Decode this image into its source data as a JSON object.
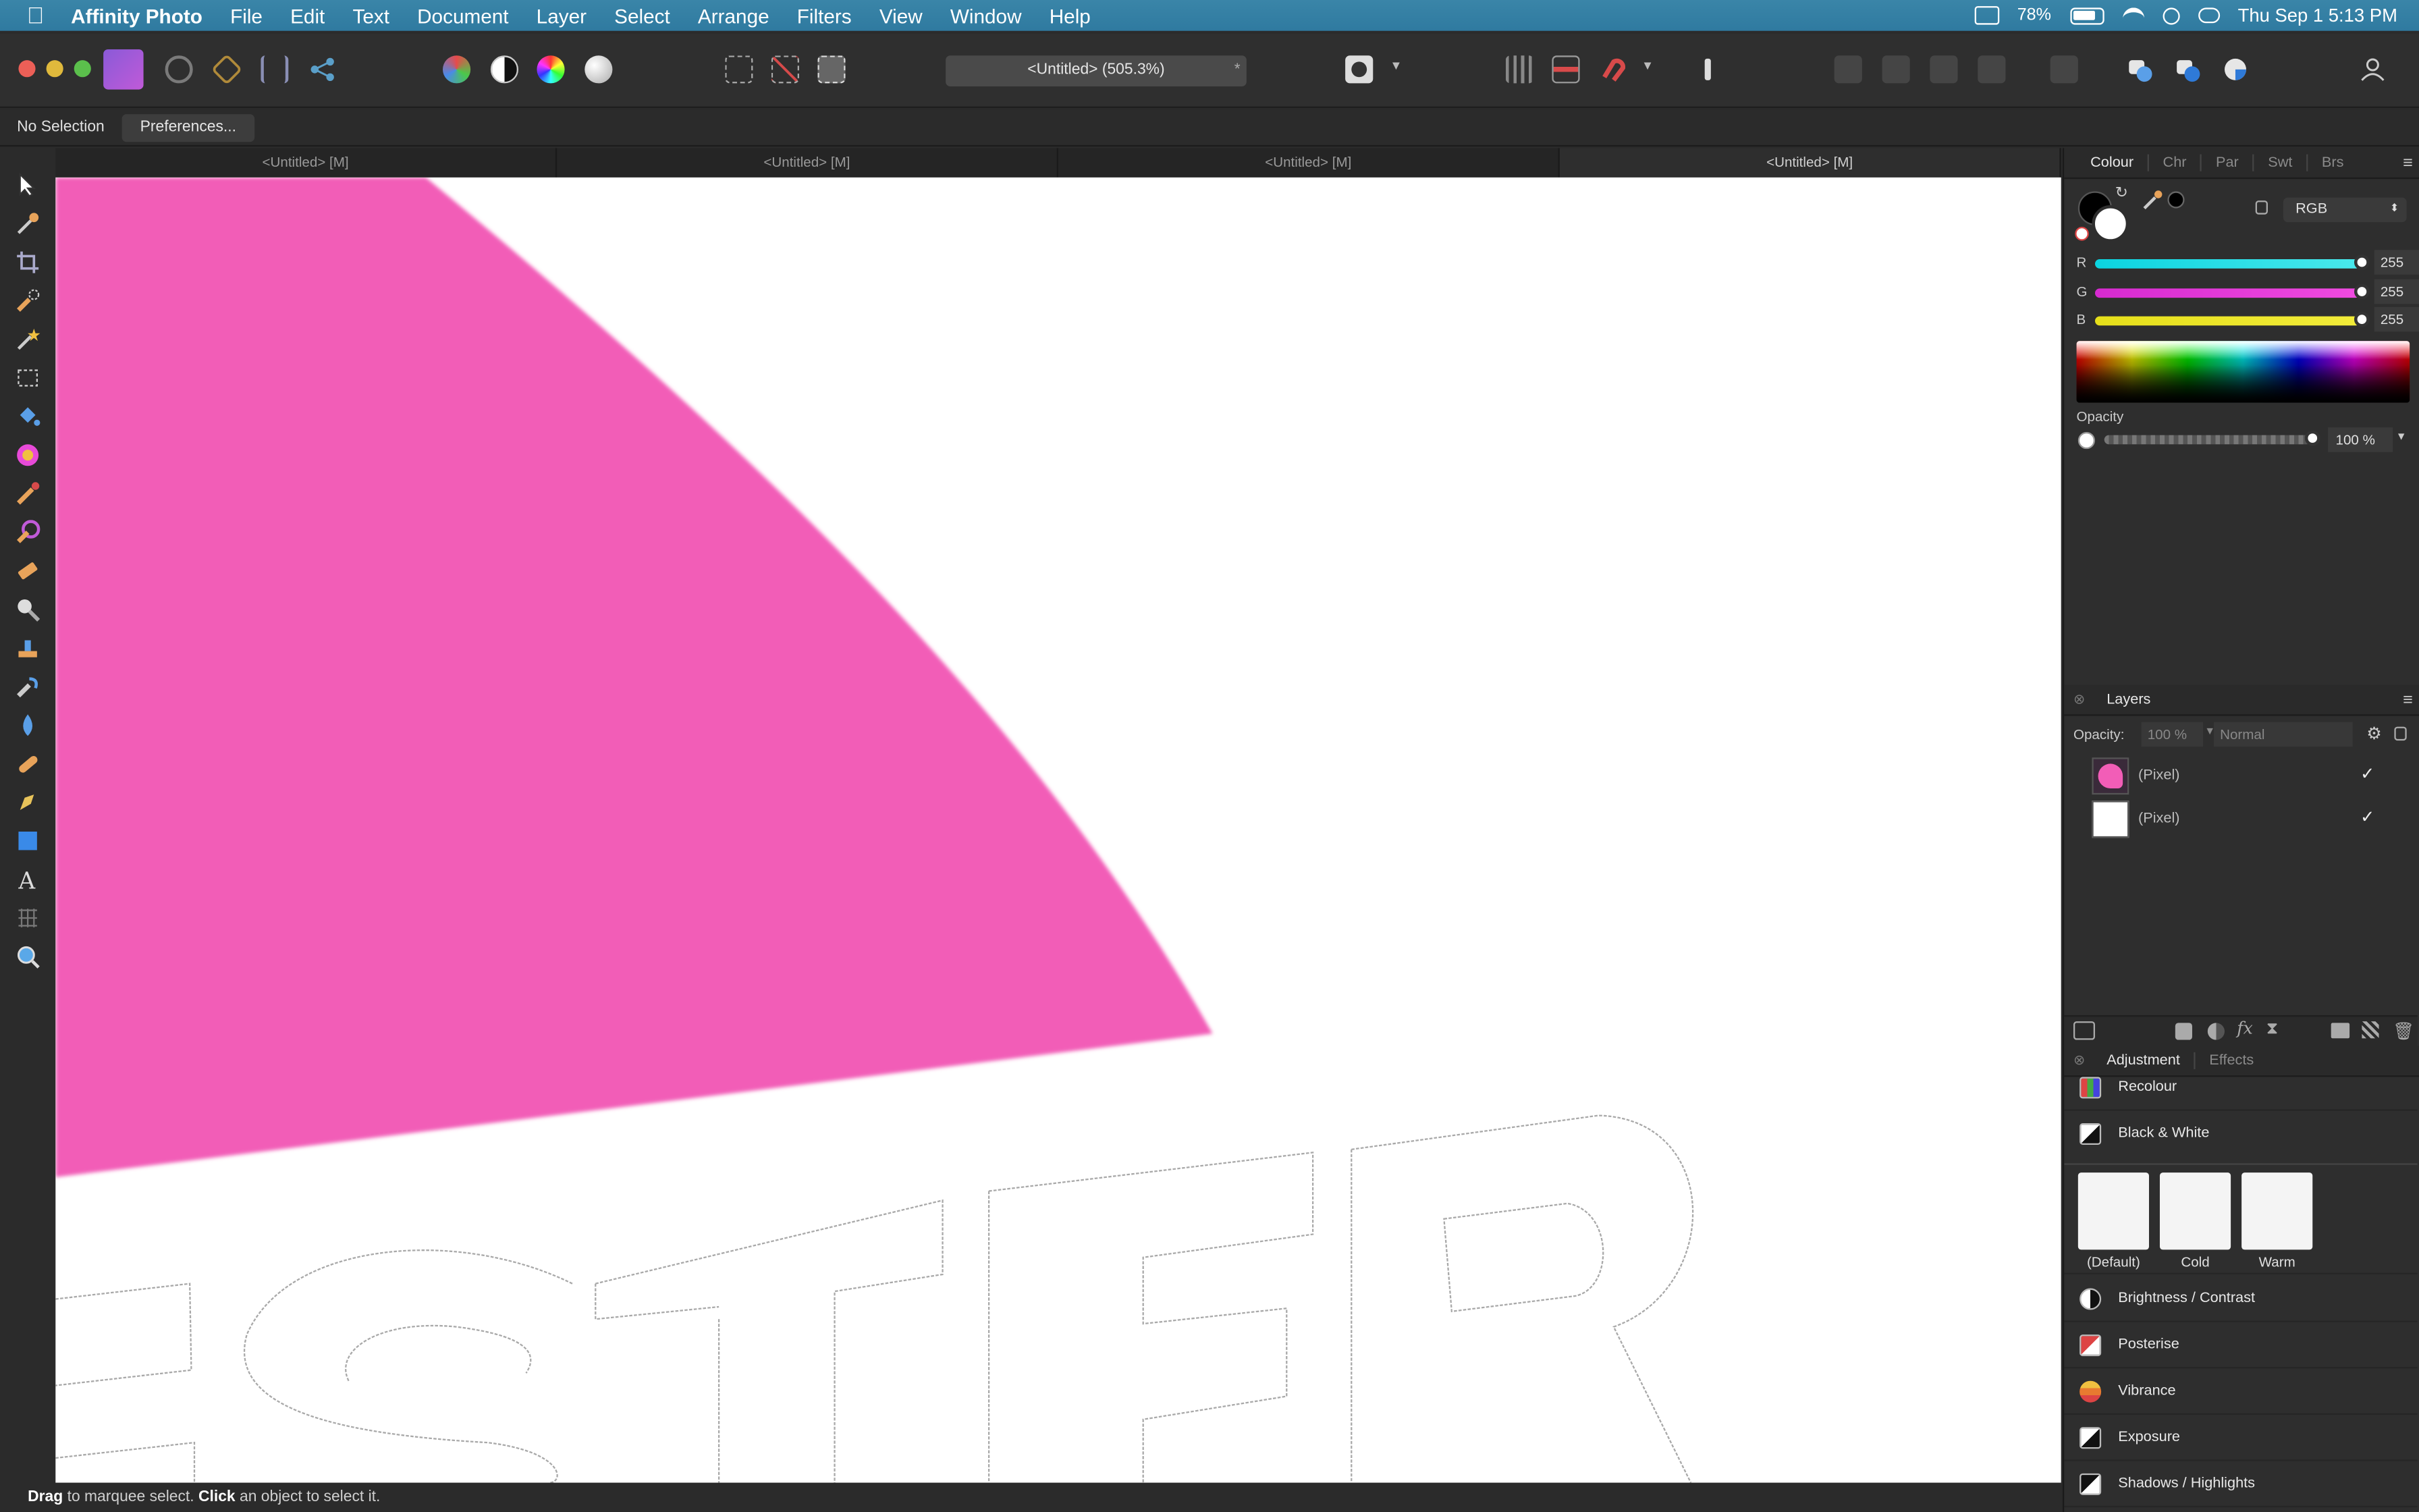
{
  "menubar": {
    "app": "Affinity Photo",
    "items": [
      "File",
      "Edit",
      "Text",
      "Document",
      "Layer",
      "Select",
      "Arrange",
      "Filters",
      "View",
      "Window",
      "Help"
    ],
    "battery": "78%",
    "datetime": "Thu Sep 1  5:13 PM"
  },
  "toolbar": {
    "document_title": "<Untitled> (505.3%)",
    "modified_marker": "*"
  },
  "context": {
    "selection_status": "No Selection",
    "preferences_label": "Preferences..."
  },
  "tabs": [
    {
      "label": "<Untitled> [M]",
      "active": false
    },
    {
      "label": "<Untitled> [M]",
      "active": false
    },
    {
      "label": "<Untitled> [M]",
      "active": false
    },
    {
      "label": "<Untitled> [M]",
      "active": true
    }
  ],
  "tools": [
    "move-tool-icon",
    "colour-picker-icon",
    "crop-icon",
    "selection-brush-icon",
    "flood-select-icon",
    "marquee-icon",
    "flood-fill-icon",
    "gradient-icon",
    "paint-brush-icon",
    "colour-replacement-icon",
    "erase-brush-icon",
    "dodge-icon",
    "clone-icon",
    "smudge-icon",
    "blur-icon",
    "healing-icon",
    "pen-icon",
    "rectangle-icon",
    "text-tool-icon",
    "mesh-warp-icon",
    "zoom-icon"
  ],
  "colour_panel": {
    "tabs": [
      "Colour",
      "Chr",
      "Par",
      "Swt",
      "Brs"
    ],
    "active_tab": "Colour",
    "model": "RGB",
    "channels": [
      {
        "name": "R",
        "value": "255",
        "color": "#33d6e0"
      },
      {
        "name": "G",
        "value": "255",
        "color": "#e03bc9"
      },
      {
        "name": "B",
        "value": "255",
        "color": "#e8e021"
      }
    ],
    "opacity_label": "Opacity",
    "opacity_value": "100 %"
  },
  "layers_panel": {
    "title": "Layers",
    "opacity_label": "Opacity:",
    "opacity_value": "100 %",
    "blend_mode": "Normal",
    "layers": [
      {
        "name": "(Pixel)",
        "visible_check": "✓"
      },
      {
        "name": "(Pixel)",
        "visible_check": "✓"
      }
    ]
  },
  "adjustment_panel": {
    "tabs": [
      "Adjustment",
      "Effects"
    ],
    "active_tab": "Adjustment",
    "items_top": [
      "Recolour",
      "Black & White"
    ],
    "presets": [
      "(Default)",
      "Cold",
      "Warm"
    ],
    "items_bottom": [
      "Brightness / Contrast",
      "Posterise",
      "Vibrance",
      "Exposure",
      "Shadows / Highlights"
    ]
  },
  "status": {
    "drag": "Drag",
    "drag_text": " to marquee select. ",
    "click": "Click",
    "click_text": " an object to select it."
  },
  "canvas_text": "STER",
  "colors": {
    "accent_pink": "#f25db7",
    "menubar": "#3080a6",
    "panel_bg": "#2e2e2e"
  }
}
